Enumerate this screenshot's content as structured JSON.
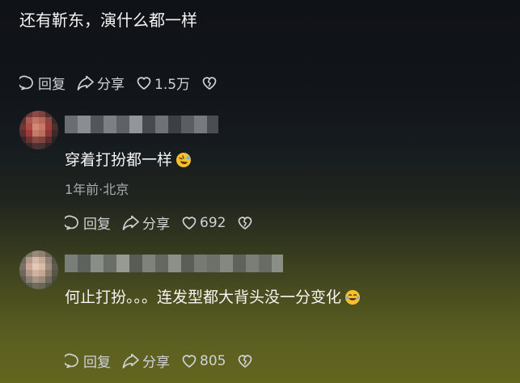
{
  "post": {
    "text": "还有靳东，演什么都一样",
    "reply_label": "回复",
    "share_label": "分享",
    "like_count": "1.5万"
  },
  "comments": [
    {
      "text": "穿着打扮都一样",
      "emoji": "rolling-on-floor-laughing",
      "meta": "1年前·北京",
      "reply_label": "回复",
      "share_label": "分享",
      "like_count": "692"
    },
    {
      "text": "何止打扮。。。连发型都大背头没一分变化",
      "emoji": "laughing-with-tears",
      "reply_label": "回复",
      "share_label": "分享",
      "like_count": "805"
    }
  ],
  "colors": {
    "text_primary": "#f4f4f4",
    "text_secondary": "#a8acb0",
    "action": "#d0d3d6"
  }
}
